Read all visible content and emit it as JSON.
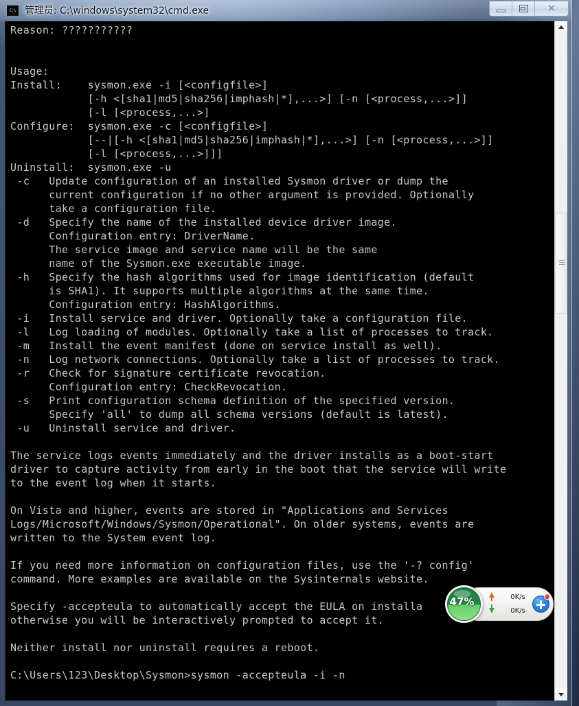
{
  "window": {
    "title": "管理员: C:\\windows\\system32\\cmd.exe",
    "icon_label": "C:\\",
    "buttons": {
      "minimize": "minimize",
      "maximize": "restore",
      "close": "✕"
    }
  },
  "console": {
    "lines": [
      "Reason: ???????????",
      "",
      "",
      "Usage:",
      "Install:    sysmon.exe -i [<configfile>]",
      "            [-h <[sha1|md5|sha256|imphash|*],...>] [-n [<process,...>]]",
      "            [-l [<process,...>]",
      "Configure:  sysmon.exe -c [<configfile>]",
      "            [--|[-h <[sha1|md5|sha256|imphash|*],...>] [-n [<process,...>]]",
      "            [-l [<process,...>]]]",
      "Uninstall:  sysmon.exe -u",
      " -c   Update configuration of an installed Sysmon driver or dump the",
      "      current configuration if no other argument is provided. Optionally",
      "      take a configuration file.",
      " -d   Specify the name of the installed device driver image.",
      "      Configuration entry: DriverName.",
      "      The service image and service name will be the same",
      "      name of the Sysmon.exe executable image.",
      " -h   Specify the hash algorithms used for image identification (default",
      "      is SHA1). It supports multiple algorithms at the same time.",
      "      Configuration entry: HashAlgorithms.",
      " -i   Install service and driver. Optionally take a configuration file.",
      " -l   Log loading of modules. Optionally take a list of processes to track.",
      " -m   Install the event manifest (done on service install as well).",
      " -n   Log network connections. Optionally take a list of processes to track.",
      " -r   Check for signature certificate revocation.",
      "      Configuration entry: CheckRevocation.",
      " -s   Print configuration schema definition of the specified version.",
      "      Specify 'all' to dump all schema versions (default is latest).",
      " -u   Uninstall service and driver.",
      "",
      "The service logs events immediately and the driver installs as a boot-start",
      "driver to capture activity from early in the boot that the service will write",
      "to the event log when it starts.",
      "",
      "On Vista and higher, events are stored in \"Applications and Services",
      "Logs/Microsoft/Windows/Sysmon/Operational\". On older systems, events are",
      "written to the System event log.",
      "",
      "If you need more information on configuration files, use the '-? config'",
      "command. More examples are available on the Sysinternals website.",
      "",
      "Specify -accepteula to automatically accept the EULA on installa",
      "otherwise you will be interactively prompted to accept it.",
      "",
      "Neither install nor uninstall requires a reboot.",
      "",
      "C:\\Users\\123\\Desktop\\Sysmon>sysmon -accepteula -i -n"
    ]
  },
  "scrollbar": {
    "up_arrow": "scroll-up",
    "down_arrow": "scroll-down"
  },
  "net_widget": {
    "percent": "47%",
    "upload_speed": "0K/s",
    "download_speed": "0K/s",
    "add_button": "+"
  },
  "colors": {
    "console_bg": "#000000",
    "console_fg": "#c8c8c8",
    "gauge_green": "#63cf6b",
    "accent_blue": "#2f86e0",
    "badge_red": "#e02020"
  }
}
